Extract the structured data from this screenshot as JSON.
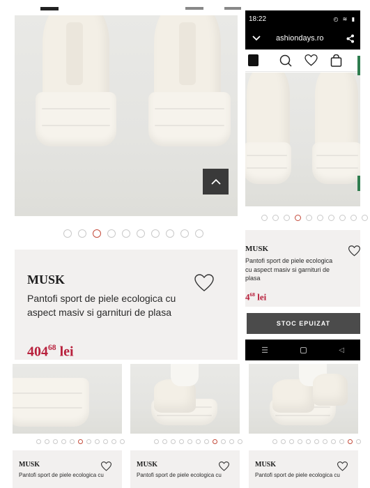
{
  "phone": {
    "time": "18:22",
    "url": "ashiondays.ro",
    "button_label": "STOC EPUIZAT"
  },
  "main_product": {
    "brand": "MUSK",
    "description": "Pantofi sport de piele ecologica cu aspect masiv si garnituri de plasa",
    "price_int": "404",
    "price_dec": "68",
    "currency": "lei",
    "gallery_dots": 10,
    "gallery_active_index": 2
  },
  "phone_product": {
    "brand": "MUSK",
    "description": "Pantofi sport de piele ecologica cu aspect masiv si garnituri de plasa",
    "price_partial": "4",
    "price_dec": "68",
    "currency": "lei",
    "gallery_dots": 11,
    "gallery_active_index": 3
  },
  "bottom_cards": [
    {
      "brand": "MUSK",
      "description": "Pantofi sport de piele ecologica cu",
      "dots": 11,
      "active": 5
    },
    {
      "brand": "MUSK",
      "description": "Pantofi sport de piele ecologica cu",
      "dots": 11,
      "active": 7
    },
    {
      "brand": "MUSK",
      "description": "Pantofi sport de piele ecologica cu",
      "dots": 11,
      "active": 9
    }
  ],
  "icons": {
    "scroll_top": "chevron-up-icon",
    "favorite": "heart-icon",
    "menu": "chevron-down-icon",
    "share": "share-icon",
    "logo": "fashiondays-logo-icon",
    "search": "search-icon",
    "bag": "shopping-bag-icon"
  },
  "colors": {
    "price": "#b8203c",
    "active_dot": "#c44a3a",
    "button": "#4b4b4b"
  }
}
